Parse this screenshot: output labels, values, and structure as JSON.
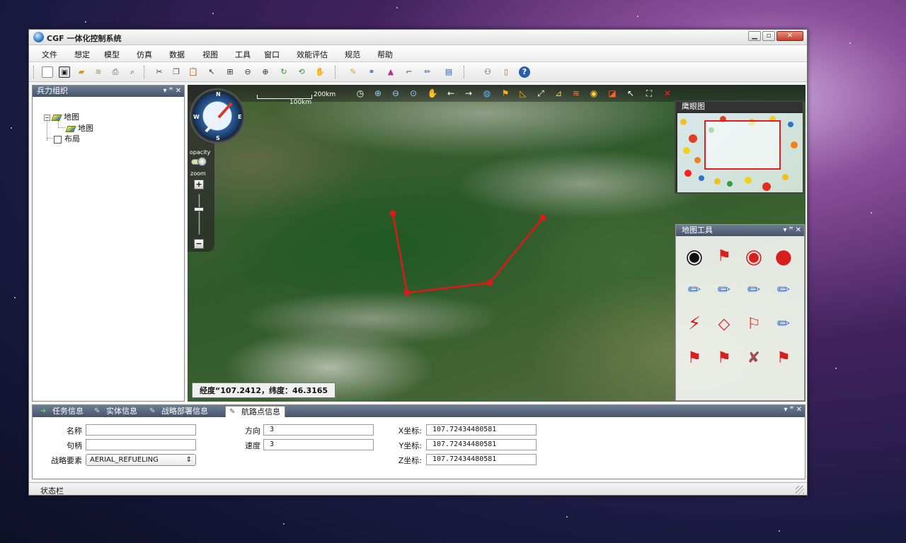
{
  "window": {
    "title": "CGF 一体化控制系统",
    "controls": {
      "minimize": "▁",
      "maximize": "▫",
      "close": "✕"
    }
  },
  "menu": [
    "文件",
    "想定",
    "模型",
    "仿真",
    "数据",
    "视图",
    "工具",
    "窗口",
    "效能评估",
    "规范",
    "帮助"
  ],
  "toolbar_icons": [
    "new-file-icon",
    "save-icon",
    "open-folder-icon",
    "layers-icon",
    "print-icon",
    "print-preview-icon",
    "cut-icon",
    "copy-icon",
    "paste-icon",
    "pointer-icon",
    "grid-select-icon",
    "zoom-out-icon",
    "zoom-in-icon",
    "refresh-icon",
    "rotate-icon",
    "pan-hand-icon",
    "pen-icon",
    "network-icon",
    "chart-icon",
    "measure-icon",
    "edit-icon",
    "window-icon",
    "binoculars-icon",
    "book-icon",
    "help-icon"
  ],
  "left_panel": {
    "title": "兵力组织",
    "tree": {
      "root_label": "地图",
      "child_label": "地图",
      "layout_label": "布局"
    }
  },
  "map": {
    "scale_200": "200km",
    "scale_100": "100km",
    "nav_opacity_label": "opacity",
    "nav_zoom_label": "zoom",
    "compass_letters": {
      "n": "N",
      "e": "E",
      "s": "S",
      "w": "W"
    },
    "coords_text": "经度“107.2412，纬度：46.3165",
    "route_color": "#dd1a1a",
    "overview_title": "鹰眼图"
  },
  "map_tools": {
    "title": "地图工具",
    "icons": [
      "target-icon",
      "flag-icon",
      "record-icon",
      "signal-wave-icon",
      "pen-point-icon",
      "pen-curve-icon",
      "pen-box-icon",
      "pen-circles-icon",
      "zigzag-icon",
      "diamond-icon",
      "diamond-flag-icon",
      "pen-delete-icon",
      "flag-diamond-1-icon",
      "flag-diamond-2-icon",
      "flag-diamond-crossed-icon",
      "flag-diamond-3-icon"
    ]
  },
  "bottom_panel": {
    "tabs": [
      "任务信息",
      "实体信息",
      "战略部署信息",
      "航路点信息"
    ],
    "active_tab": "航路点信息",
    "labels": {
      "name": "名称",
      "handle": "句柄",
      "element": "战略要素",
      "direction": "方向",
      "speed": "速度",
      "x": "X坐标:",
      "y": "Y坐标:",
      "z": "Z坐标:"
    },
    "values": {
      "name": "",
      "handle": "",
      "element": "AERIAL_REFUELING",
      "direction": "3",
      "speed": "3",
      "x": "107.72434480581",
      "y": "107.72434480581",
      "z": "107.72434480581"
    },
    "panel_controls": "▾ ꟸ ✕"
  },
  "status": {
    "text": "状态栏"
  }
}
